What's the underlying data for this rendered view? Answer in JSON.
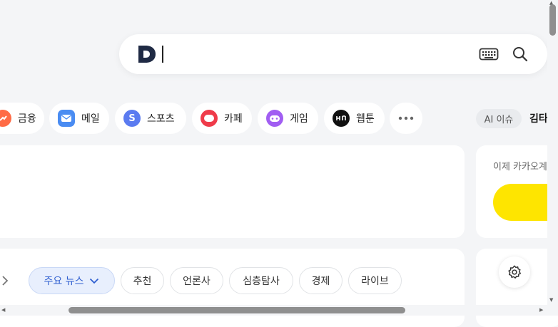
{
  "search": {
    "logo_letter": "D",
    "placeholder": ""
  },
  "shortcuts": [
    {
      "label": "금융",
      "icon": "finance-icon",
      "color": "#ff6b45"
    },
    {
      "label": "메일",
      "icon": "mail-icon",
      "color": "#4a8cf2"
    },
    {
      "label": "스포츠",
      "icon": "sports-icon",
      "color": "#5b7bf0"
    },
    {
      "label": "카페",
      "icon": "cafe-icon",
      "color": "#ef3b4a"
    },
    {
      "label": "게임",
      "icon": "game-icon",
      "color": "#a15ef2"
    },
    {
      "label": "웹툰",
      "icon": "webtoon-icon",
      "color": "#111111"
    }
  ],
  "ai_issue": {
    "badge": "AI 이슈",
    "text": "김타"
  },
  "side_card": {
    "title": "이제 카카오계"
  },
  "news_tabs": [
    "주요 뉴스",
    "추천",
    "언론사",
    "심층탐사",
    "경제",
    "라이브"
  ]
}
